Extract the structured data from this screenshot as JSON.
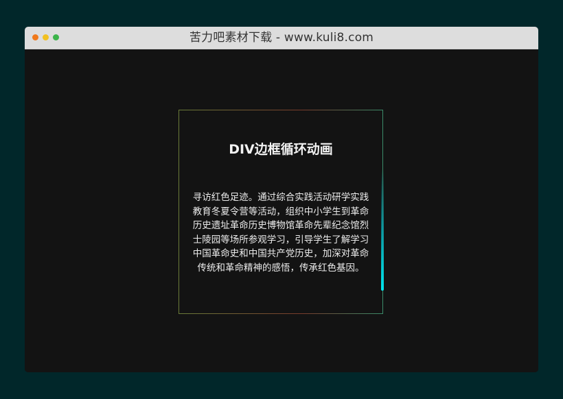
{
  "window": {
    "title": "苦力吧素材下载 - www.kuli8.com",
    "controls": [
      {
        "name": "close",
        "color": "#f0791b"
      },
      {
        "name": "minimize",
        "color": "#f2c020"
      },
      {
        "name": "maximize",
        "color": "#3cb44a"
      }
    ]
  },
  "card": {
    "title": "DIV边框循环动画",
    "text": "寻访红色足迹。通过综合实践活动研学实践教育冬夏令营等活动，组织中小学生到革命历史遗址革命历史博物馆革命先辈纪念馆烈士陵园等场所参观学习，引导学生了解学习中国革命史和中国共产党历史，加深对革命传统和革命精神的感悟，传承红色基因。",
    "accent_color": "#00e5ee"
  }
}
